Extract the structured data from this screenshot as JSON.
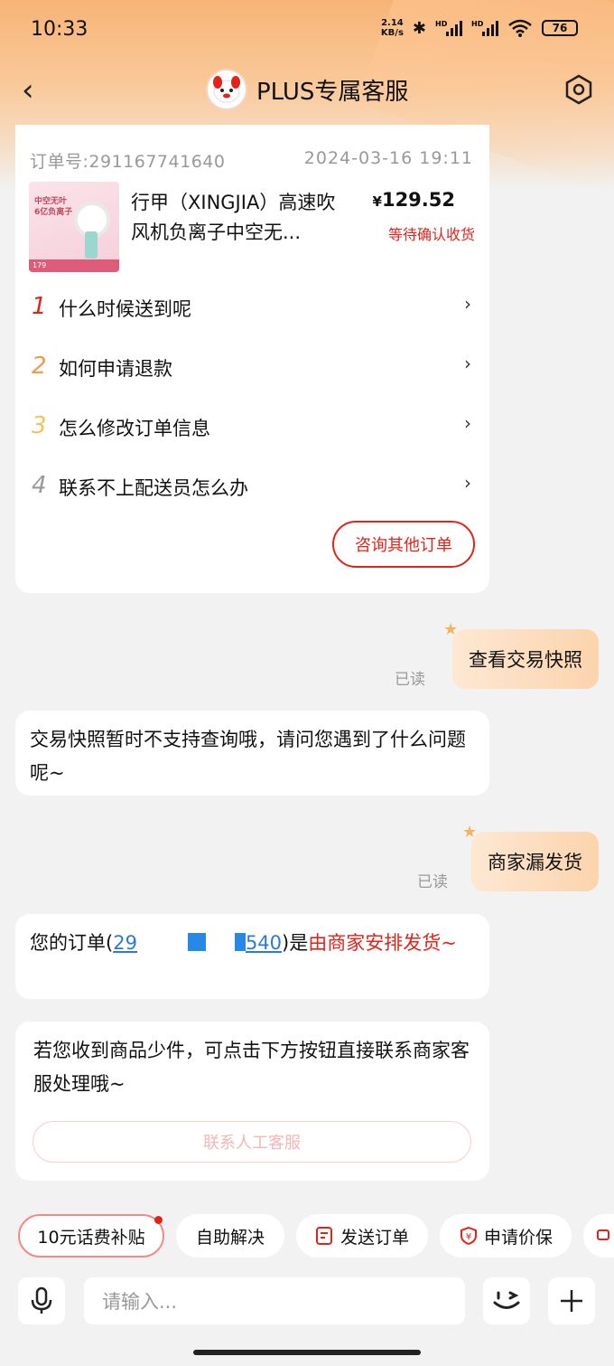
{
  "status_bar": {
    "time": "10:33",
    "net_speed_top": "2.14",
    "net_speed_bottom": "KB/s",
    "battery": "76"
  },
  "nav": {
    "title": "PLUS专属客服"
  },
  "order": {
    "order_no": "订单号:291167741640",
    "date": "2024-03-16  19:11",
    "product_name": "行甲（XINGJIA）高速吹风机负离子中空无...",
    "price_symbol": "¥",
    "price": "129.52",
    "status": "等待确认收货",
    "image_text": "中空无叶\n6亿负离子",
    "image_price": "179"
  },
  "faq": [
    {
      "num": "1",
      "label": "什么时候送到呢",
      "color": "#e2231a"
    },
    {
      "num": "2",
      "label": "如何申请退款",
      "color": "#f29a4a"
    },
    {
      "num": "3",
      "label": "怎么修改订单信息",
      "color": "#f5c15c"
    },
    {
      "num": "4",
      "label": "联系不上配送员怎么办",
      "color": "#999999"
    }
  ],
  "consult_button": "咨询其他订单",
  "messages": {
    "user1": "查看交易快照",
    "read1": "已读",
    "bot1": "交易快照暂时不支持查询哦，请问您遇到了什么问题呢~",
    "user2": "商家漏发货",
    "read2": "已读",
    "bot2_prefix": "您的订单(",
    "bot2_link_start": "29",
    "bot2_link_end": "540",
    "bot2_middle": ")是",
    "bot2_red": "由商家安排发货~",
    "bot3": "若您收到商品少件，可点击下方按钮直接联系商家客服处理哦~",
    "bot3_button": "联系人工客服"
  },
  "chips": [
    {
      "label": "10元话费补贴",
      "icon": ""
    },
    {
      "label": "自助解决",
      "icon": ""
    },
    {
      "label": "发送订单",
      "icon": "order-icon"
    },
    {
      "label": "申请价保",
      "icon": "shield-yen-icon"
    }
  ],
  "input": {
    "placeholder": "请输入..."
  },
  "colors": {
    "accent": "#e2231a",
    "link": "#2a7ad6",
    "bubble": "#fcd4ad"
  }
}
